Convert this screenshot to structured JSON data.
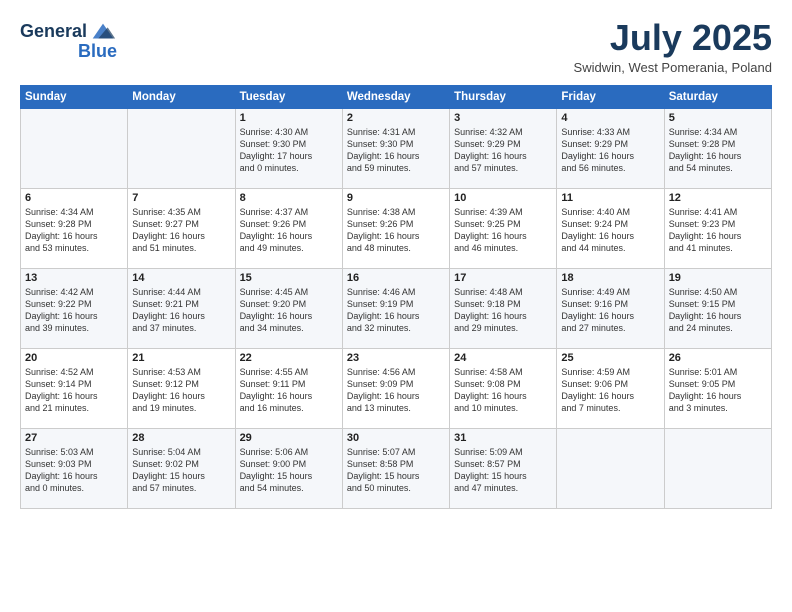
{
  "header": {
    "logo_line1": "General",
    "logo_line2": "Blue",
    "month_title": "July 2025",
    "location": "Swidwin, West Pomerania, Poland"
  },
  "weekdays": [
    "Sunday",
    "Monday",
    "Tuesday",
    "Wednesday",
    "Thursday",
    "Friday",
    "Saturday"
  ],
  "weeks": [
    [
      {
        "day": "",
        "text": ""
      },
      {
        "day": "",
        "text": ""
      },
      {
        "day": "1",
        "text": "Sunrise: 4:30 AM\nSunset: 9:30 PM\nDaylight: 17 hours\nand 0 minutes."
      },
      {
        "day": "2",
        "text": "Sunrise: 4:31 AM\nSunset: 9:30 PM\nDaylight: 16 hours\nand 59 minutes."
      },
      {
        "day": "3",
        "text": "Sunrise: 4:32 AM\nSunset: 9:29 PM\nDaylight: 16 hours\nand 57 minutes."
      },
      {
        "day": "4",
        "text": "Sunrise: 4:33 AM\nSunset: 9:29 PM\nDaylight: 16 hours\nand 56 minutes."
      },
      {
        "day": "5",
        "text": "Sunrise: 4:34 AM\nSunset: 9:28 PM\nDaylight: 16 hours\nand 54 minutes."
      }
    ],
    [
      {
        "day": "6",
        "text": "Sunrise: 4:34 AM\nSunset: 9:28 PM\nDaylight: 16 hours\nand 53 minutes."
      },
      {
        "day": "7",
        "text": "Sunrise: 4:35 AM\nSunset: 9:27 PM\nDaylight: 16 hours\nand 51 minutes."
      },
      {
        "day": "8",
        "text": "Sunrise: 4:37 AM\nSunset: 9:26 PM\nDaylight: 16 hours\nand 49 minutes."
      },
      {
        "day": "9",
        "text": "Sunrise: 4:38 AM\nSunset: 9:26 PM\nDaylight: 16 hours\nand 48 minutes."
      },
      {
        "day": "10",
        "text": "Sunrise: 4:39 AM\nSunset: 9:25 PM\nDaylight: 16 hours\nand 46 minutes."
      },
      {
        "day": "11",
        "text": "Sunrise: 4:40 AM\nSunset: 9:24 PM\nDaylight: 16 hours\nand 44 minutes."
      },
      {
        "day": "12",
        "text": "Sunrise: 4:41 AM\nSunset: 9:23 PM\nDaylight: 16 hours\nand 41 minutes."
      }
    ],
    [
      {
        "day": "13",
        "text": "Sunrise: 4:42 AM\nSunset: 9:22 PM\nDaylight: 16 hours\nand 39 minutes."
      },
      {
        "day": "14",
        "text": "Sunrise: 4:44 AM\nSunset: 9:21 PM\nDaylight: 16 hours\nand 37 minutes."
      },
      {
        "day": "15",
        "text": "Sunrise: 4:45 AM\nSunset: 9:20 PM\nDaylight: 16 hours\nand 34 minutes."
      },
      {
        "day": "16",
        "text": "Sunrise: 4:46 AM\nSunset: 9:19 PM\nDaylight: 16 hours\nand 32 minutes."
      },
      {
        "day": "17",
        "text": "Sunrise: 4:48 AM\nSunset: 9:18 PM\nDaylight: 16 hours\nand 29 minutes."
      },
      {
        "day": "18",
        "text": "Sunrise: 4:49 AM\nSunset: 9:16 PM\nDaylight: 16 hours\nand 27 minutes."
      },
      {
        "day": "19",
        "text": "Sunrise: 4:50 AM\nSunset: 9:15 PM\nDaylight: 16 hours\nand 24 minutes."
      }
    ],
    [
      {
        "day": "20",
        "text": "Sunrise: 4:52 AM\nSunset: 9:14 PM\nDaylight: 16 hours\nand 21 minutes."
      },
      {
        "day": "21",
        "text": "Sunrise: 4:53 AM\nSunset: 9:12 PM\nDaylight: 16 hours\nand 19 minutes."
      },
      {
        "day": "22",
        "text": "Sunrise: 4:55 AM\nSunset: 9:11 PM\nDaylight: 16 hours\nand 16 minutes."
      },
      {
        "day": "23",
        "text": "Sunrise: 4:56 AM\nSunset: 9:09 PM\nDaylight: 16 hours\nand 13 minutes."
      },
      {
        "day": "24",
        "text": "Sunrise: 4:58 AM\nSunset: 9:08 PM\nDaylight: 16 hours\nand 10 minutes."
      },
      {
        "day": "25",
        "text": "Sunrise: 4:59 AM\nSunset: 9:06 PM\nDaylight: 16 hours\nand 7 minutes."
      },
      {
        "day": "26",
        "text": "Sunrise: 5:01 AM\nSunset: 9:05 PM\nDaylight: 16 hours\nand 3 minutes."
      }
    ],
    [
      {
        "day": "27",
        "text": "Sunrise: 5:03 AM\nSunset: 9:03 PM\nDaylight: 16 hours\nand 0 minutes."
      },
      {
        "day": "28",
        "text": "Sunrise: 5:04 AM\nSunset: 9:02 PM\nDaylight: 15 hours\nand 57 minutes."
      },
      {
        "day": "29",
        "text": "Sunrise: 5:06 AM\nSunset: 9:00 PM\nDaylight: 15 hours\nand 54 minutes."
      },
      {
        "day": "30",
        "text": "Sunrise: 5:07 AM\nSunset: 8:58 PM\nDaylight: 15 hours\nand 50 minutes."
      },
      {
        "day": "31",
        "text": "Sunrise: 5:09 AM\nSunset: 8:57 PM\nDaylight: 15 hours\nand 47 minutes."
      },
      {
        "day": "",
        "text": ""
      },
      {
        "day": "",
        "text": ""
      }
    ]
  ]
}
